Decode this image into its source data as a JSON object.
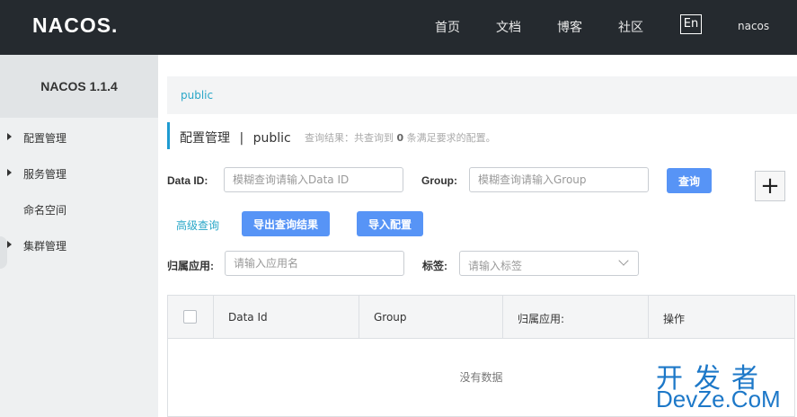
{
  "header": {
    "logo": "NACOS.",
    "nav": [
      "首页",
      "文档",
      "博客",
      "社区"
    ],
    "lang": "En",
    "user": "nacos"
  },
  "sidebar": {
    "title": "NACOS 1.1.4",
    "items": [
      {
        "label": "配置管理",
        "expandable": true
      },
      {
        "label": "服务管理",
        "expandable": true
      },
      {
        "label": "命名空间",
        "expandable": false
      },
      {
        "label": "集群管理",
        "expandable": true
      }
    ]
  },
  "breadcrumb": "public",
  "title": {
    "main": "配置管理",
    "separator": "|",
    "namespace": "public",
    "query_prefix": "查询结果：共查询到",
    "query_count": "0",
    "query_suffix": "条满足要求的配置。"
  },
  "filters": {
    "data_id_label": "Data ID:",
    "data_id_placeholder": "模糊查询请输入Data ID",
    "group_label": "Group:",
    "group_placeholder": "模糊查询请输入Group",
    "query_button": "查询",
    "add_button": "+",
    "advanced": "高级查询",
    "export_button": "导出查询结果",
    "import_button": "导入配置",
    "app_label": "归属应用:",
    "app_placeholder": "请输入应用名",
    "tag_label": "标签:",
    "tag_placeholder": "请输入标签"
  },
  "table": {
    "columns": [
      "Data Id",
      "Group",
      "归属应用:",
      "操作"
    ],
    "empty": "没有数据"
  },
  "watermark": {
    "line1": "开发者",
    "line2": "DevZe.CoM"
  },
  "colors": {
    "topbar": "#252a2f",
    "primary": "#5794f6",
    "link": "#2aa7c8",
    "accent_bar": "#1e9bd1"
  }
}
